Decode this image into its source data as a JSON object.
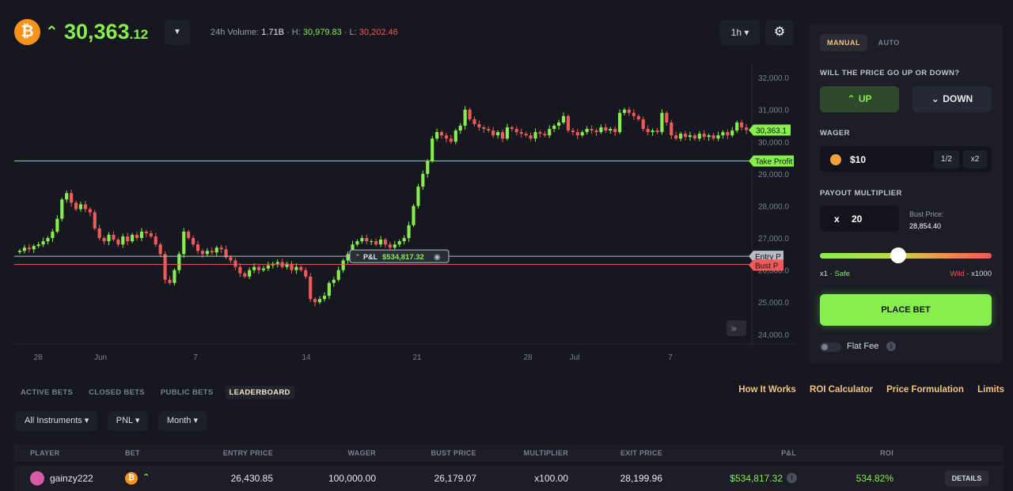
{
  "header": {
    "coin_symbol": "₿",
    "price_main": "30,363",
    "price_decimals": ".12",
    "volume_label": "24h Volume:",
    "volume_value": "1.71B",
    "high_label": "· H:",
    "high_value": "30,979.83",
    "low_label": "· L:",
    "low_value": "30,202.46",
    "timeframe": "1h ▾",
    "dropdown_icon": "chevron-down-icon",
    "settings_icon": "gear-icon"
  },
  "chart_data": {
    "type": "candlestick",
    "yticks": [
      "32,000.0",
      "31,000.0",
      "30,000.0",
      "29,000.0",
      "28,000.0",
      "27,000.0",
      "26,000.0",
      "25,000.0",
      "24,000.0"
    ],
    "ytick_values": [
      32000,
      31000,
      30000,
      29000,
      28000,
      27000,
      26000,
      25000,
      24000
    ],
    "xticks": [
      "28",
      "Jun",
      "7",
      "14",
      "21",
      "28",
      "Jul",
      "7"
    ],
    "ylim": [
      23700,
      32200
    ],
    "current_price_label": "30,363.1",
    "current_price": 30363.1,
    "take_profit_label": "Take Profit",
    "take_profit": 29400,
    "entry_label": "Entry P",
    "entry_price": 26430.85,
    "bust_label": "Bust P",
    "bust_price": 26179.07,
    "pnl_label": "P&L",
    "pnl_value": "$534,817.32",
    "close_series": [
      26600,
      26700,
      26650,
      26750,
      26800,
      26900,
      27000,
      27200,
      27600,
      28200,
      28400,
      28100,
      27900,
      28050,
      27900,
      27800,
      27300,
      27000,
      26900,
      27100,
      26950,
      26800,
      27050,
      26900,
      27100,
      27000,
      27200,
      27150,
      27050,
      26800,
      26500,
      25700,
      25600,
      26000,
      26500,
      27200,
      27000,
      26800,
      26600,
      26500,
      26600,
      26550,
      26700,
      26650,
      26400,
      26300,
      26100,
      25900,
      25800,
      26000,
      26100,
      26000,
      26050,
      26150,
      26200,
      26250,
      26100,
      26200,
      26000,
      26100,
      26000,
      25800,
      25100,
      25000,
      25100,
      25200,
      25600,
      25700,
      26000,
      26300,
      26500,
      26800,
      26900,
      27000,
      26900,
      26900,
      26800,
      26950,
      26800,
      26700,
      26800,
      26900,
      27000,
      27400,
      28000,
      28600,
      29000,
      29400,
      30100,
      30300,
      30200,
      30100,
      30000,
      30350,
      30500,
      31000,
      30700,
      30550,
      30450,
      30400,
      30350,
      30200,
      30300,
      30100,
      30450,
      30400,
      30300,
      30250,
      30200,
      30100,
      30300,
      30250,
      30200,
      30400,
      30500,
      30600,
      30800,
      30350,
      30300,
      30200,
      30300,
      30400,
      30350,
      30300,
      30450,
      30350,
      30400,
      30300,
      30900,
      31000,
      30900,
      30800,
      30700,
      30400,
      30300,
      30350,
      30300,
      30900,
      30600,
      30200,
      30100,
      30250,
      30150,
      30200,
      30100,
      30250,
      30150,
      30200,
      30100,
      30200,
      30300,
      30200,
      30350,
      30600,
      30450,
      30363
    ]
  },
  "chart_controls": {
    "scroll_icon": "double-chevron-right-icon",
    "eye_icon": "eye-icon"
  },
  "panel": {
    "tabs": [
      "MANUAL",
      "AUTO"
    ],
    "question": "WILL THE PRICE GO UP OR DOWN?",
    "up_label": "UP",
    "down_label": "DOWN",
    "up_icon": "double-chevron-up-icon",
    "down_icon": "double-chevron-down-icon",
    "wager_label": "WAGER",
    "wager_value": "$10",
    "half_label": "1/2",
    "double_label": "x2",
    "payout_label": "PAYOUT MULTIPLIER",
    "mult_prefix": "x",
    "mult_value": "20",
    "bust_label": "Bust Price:",
    "bust_value": "28,854.40",
    "slider_position": 0.45,
    "safe_prefix": "x1 ·",
    "safe_label": "Safe",
    "wild_label": "Wild",
    "wild_suffix": "· x1000",
    "place_bet": "PLACE BET",
    "flat_fee": "Flat Fee",
    "info_icon": "i"
  },
  "bottom": {
    "tabs": [
      "ACTIVE BETS",
      "CLOSED BETS",
      "PUBLIC BETS",
      "LEADERBOARD"
    ],
    "links": [
      "How It Works",
      "ROI Calculator",
      "Price Formulation",
      "Limits"
    ],
    "filters": [
      "All Instruments ▾",
      "PNL ▾",
      "Month ▾"
    ],
    "columns": [
      "PLAYER",
      "BET",
      "ENTRY PRICE",
      "WAGER",
      "BUST PRICE",
      "MULTIPLIER",
      "EXIT PRICE",
      "P&L",
      "ROI"
    ],
    "row": {
      "player": "gainzy222",
      "coin": "₿",
      "direction": "up",
      "entry": "26,430.85",
      "wager": "100,000.00",
      "bust": "26,179.07",
      "multiplier": "x100.00",
      "exit": "28,199.96",
      "pnl": "$534,817.32",
      "roi": "534.82%",
      "details": "DETAILS"
    }
  },
  "colors": {
    "accent_green": "#86ef4f",
    "accent_red": "#f05a5a",
    "gold": "#f3c57c",
    "bitcoin": "#f7931a"
  }
}
